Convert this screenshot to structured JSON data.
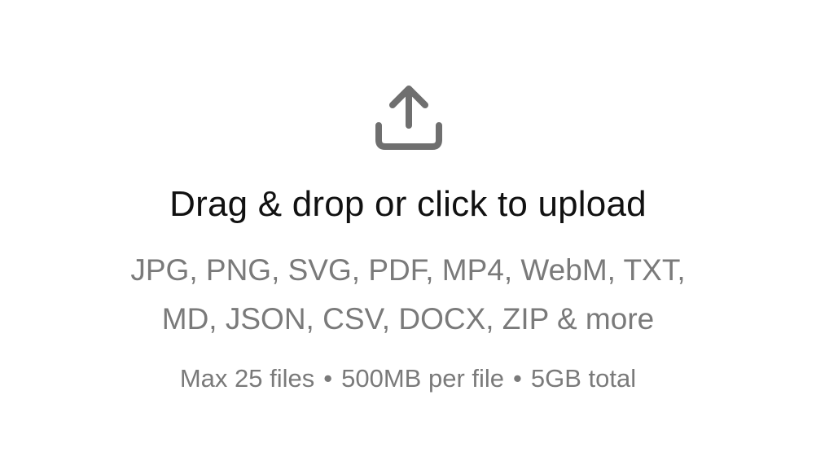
{
  "dropzone": {
    "icon": "upload-icon",
    "icon_color": "#6f6f6f",
    "title": "Drag & drop or click to upload",
    "formats_line1": "JPG, PNG, SVG, PDF, MP4, WebM, TXT,",
    "formats_line2": "MD, JSON, CSV, DOCX, ZIP & more",
    "limits": {
      "max_files": "Max 25 files",
      "separator": "•",
      "per_file": "500MB per file",
      "total": "5GB total"
    }
  }
}
